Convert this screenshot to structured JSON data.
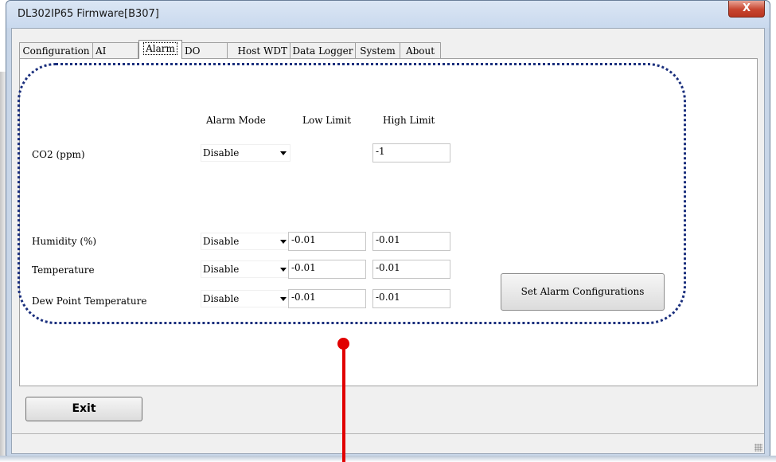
{
  "window": {
    "title": "DL302IP65 Firmware[B307]",
    "close_glyph": "X"
  },
  "tabs": [
    {
      "label": "Configuration"
    },
    {
      "label": "AI"
    },
    {
      "label": "Alarm",
      "active": true
    },
    {
      "label": "DO"
    },
    {
      "label": "Host WDT"
    },
    {
      "label": "Data Logger"
    },
    {
      "label": "System"
    },
    {
      "label": "About"
    }
  ],
  "alarm": {
    "headers": {
      "mode": "Alarm Mode",
      "low": "Low Limit",
      "high": "High Limit"
    },
    "rows": [
      {
        "label": "CO2 (ppm)",
        "mode": "Disable",
        "high": "-1"
      },
      {
        "label": "Humidity (%)",
        "mode": "Disable",
        "low": "-0.01",
        "high": "-0.01"
      },
      {
        "label": "Temperature",
        "mode": "Disable",
        "low": "-0.01",
        "high": "-0.01"
      },
      {
        "label": "Dew Point Temperature",
        "mode": "Disable",
        "low": "-0.01",
        "high": "-0.01"
      }
    ],
    "set_button": "Set Alarm Configurations"
  },
  "exit_button": "Exit",
  "annotation": {
    "highlight_color": "#1a2f7d",
    "pointer_color": "#e10000"
  }
}
